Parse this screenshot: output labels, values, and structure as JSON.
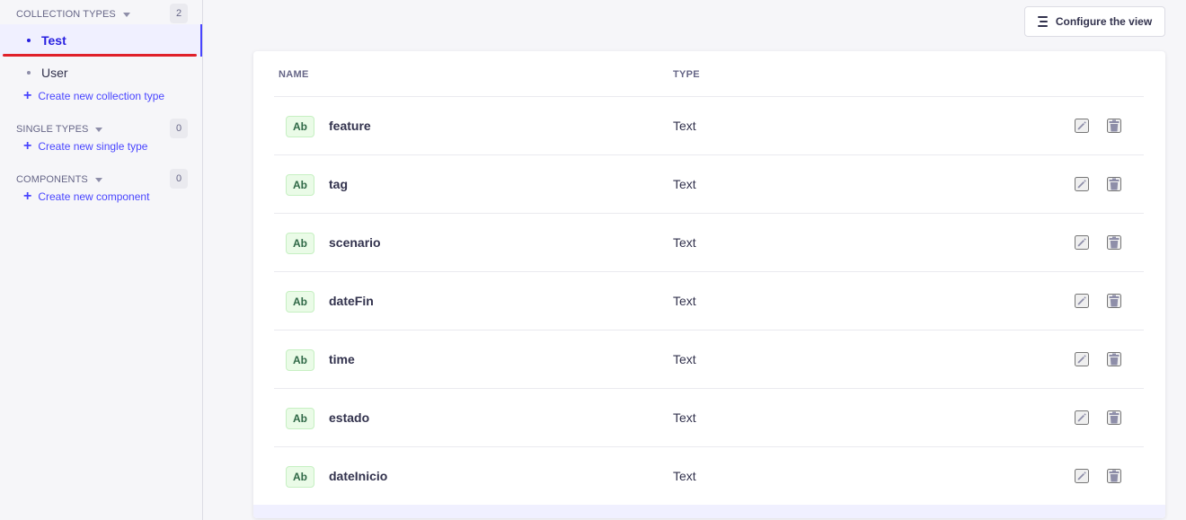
{
  "sidebar": {
    "collection_types": {
      "title": "COLLECTION TYPES",
      "count": "2",
      "items": [
        {
          "label": "Test",
          "active": true
        },
        {
          "label": "User",
          "active": false
        }
      ],
      "create_label": "Create new collection type"
    },
    "single_types": {
      "title": "SINGLE TYPES",
      "count": "0",
      "create_label": "Create new single type"
    },
    "components": {
      "title": "COMPONENTS",
      "count": "0",
      "create_label": "Create new component"
    }
  },
  "header": {
    "configure_label": "Configure the view"
  },
  "table": {
    "columns": {
      "name": "NAME",
      "type": "TYPE"
    },
    "rows": [
      {
        "badge": "Ab",
        "name": "feature",
        "type": "Text"
      },
      {
        "badge": "Ab",
        "name": "tag",
        "type": "Text"
      },
      {
        "badge": "Ab",
        "name": "scenario",
        "type": "Text"
      },
      {
        "badge": "Ab",
        "name": "dateFin",
        "type": "Text"
      },
      {
        "badge": "Ab",
        "name": "time",
        "type": "Text"
      },
      {
        "badge": "Ab",
        "name": "estado",
        "type": "Text"
      },
      {
        "badge": "Ab",
        "name": "dateInicio",
        "type": "Text"
      }
    ]
  },
  "icons": {
    "caret": "caret-down-icon",
    "plus": "plus-icon",
    "configure": "list-lines-icon",
    "edit": "pencil-icon",
    "delete": "trash-icon"
  },
  "colors": {
    "accent": "#4945ff",
    "active_bg": "#f0f0ff",
    "badge_bg": "#eafbe7",
    "badge_text": "#2f6846",
    "highlight_underline": "#e0202a"
  }
}
